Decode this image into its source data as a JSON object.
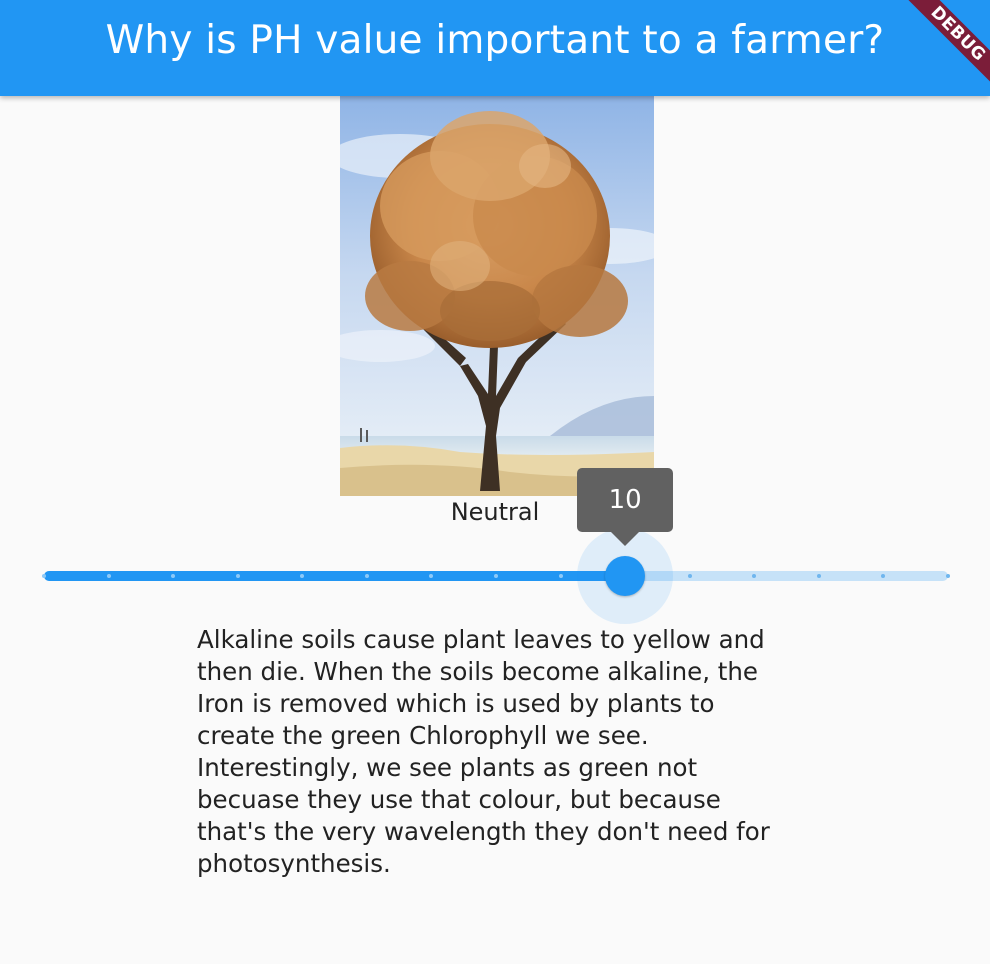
{
  "app_bar": {
    "title": "Why is PH value important to a farmer?",
    "color": "#2196f3"
  },
  "debug_banner": {
    "label": "DEBUG",
    "color": "#7b1d39"
  },
  "image": {
    "subject": "tree-photo",
    "icon": "tree-image"
  },
  "ph_label": "Neutral",
  "slider": {
    "value": 10,
    "value_label": "10",
    "min": 1,
    "max": 15,
    "divisions": 14,
    "active_color": "#2196f3",
    "inactive_color": "#c6e2f8"
  },
  "description": "Alkaline soils cause plant leaves to yellow and then die. When the soils become alkaline, the Iron is removed which is used by plants to create the green Chlorophyll we see. Interestingly, we see plants as green not becuase they use that colour, but because that's the very wavelength they don't need for photosynthesis."
}
